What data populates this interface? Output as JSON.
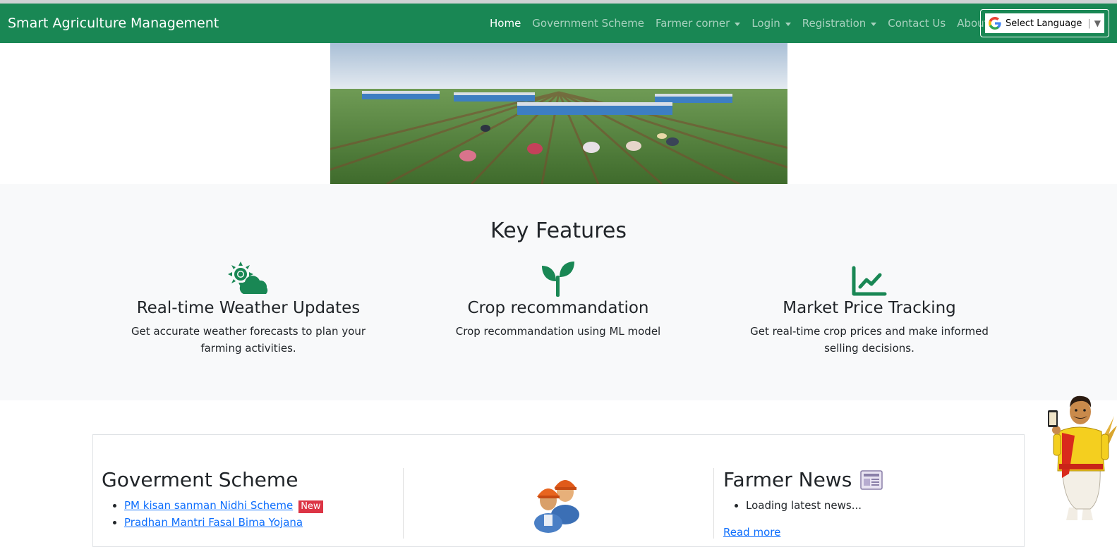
{
  "nav": {
    "brand": "Smart Agriculture Management",
    "items": [
      {
        "label": "Home",
        "active": true,
        "dropdown": false
      },
      {
        "label": "Government Scheme",
        "active": false,
        "dropdown": false
      },
      {
        "label": "Farmer corner",
        "active": false,
        "dropdown": true
      },
      {
        "label": "Login",
        "active": false,
        "dropdown": true
      },
      {
        "label": "Registration",
        "active": false,
        "dropdown": true
      },
      {
        "label": "Contact Us",
        "active": false,
        "dropdown": false
      },
      {
        "label": "About",
        "active": false,
        "dropdown": false
      }
    ],
    "language": {
      "label": "Select Language",
      "icon": "google-g-icon"
    }
  },
  "features": {
    "title": "Key Features",
    "items": [
      {
        "icon": "sun-cloud-icon",
        "title": "Real-time Weather Updates",
        "text": "Get accurate weather forecasts to plan your farming activities."
      },
      {
        "icon": "seedling-icon",
        "title": "Crop recommandation",
        "text": "Crop recommandation using ML model"
      },
      {
        "icon": "line-chart-icon",
        "title": "Market Price Tracking",
        "text": "Get real-time crop prices and make informed selling decisions."
      }
    ]
  },
  "scheme": {
    "title": "Goverment Scheme",
    "links": [
      "PM kisan sanman Nidhi Scheme",
      "Pradhan Mantri Fasal Bima Yojana"
    ],
    "badge": "New"
  },
  "news": {
    "title": "Farmer News",
    "items": [
      "Loading latest news..."
    ],
    "read_more": "Read more"
  },
  "colors": {
    "brand": "#198754",
    "link": "#0d6efd",
    "badge": "#dc3545"
  }
}
